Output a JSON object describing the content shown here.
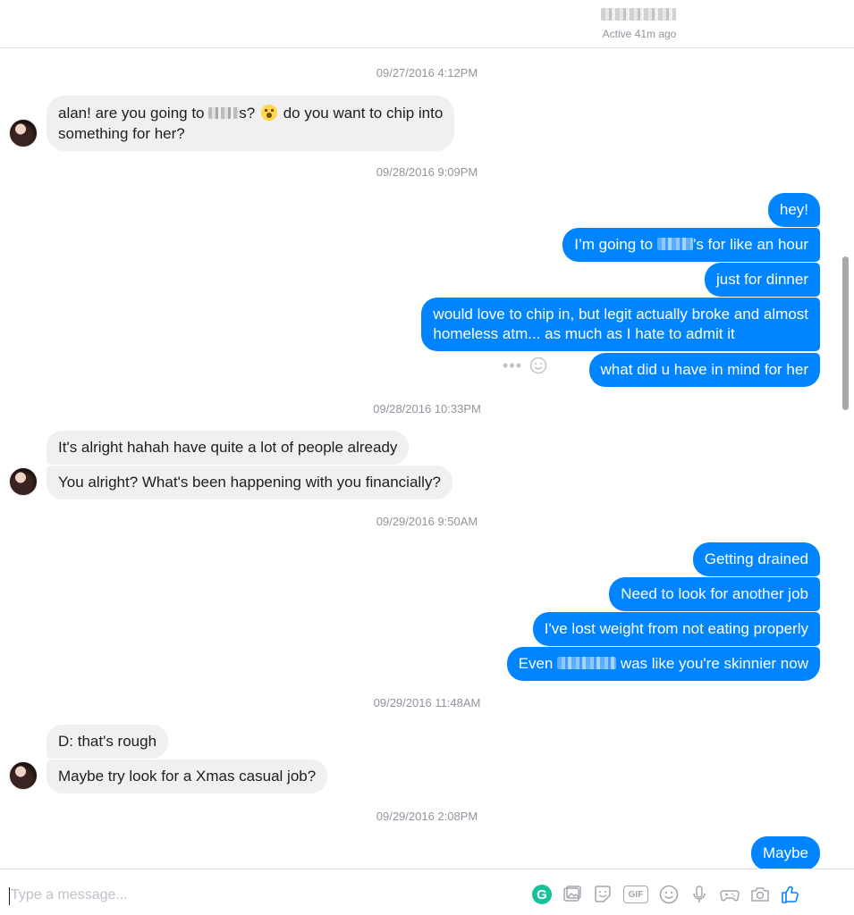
{
  "header": {
    "contact_status": "Active 41m ago"
  },
  "timestamps": [
    "09/27/2016 4:12PM",
    "09/28/2016 9:09PM",
    "09/28/2016 10:33PM",
    "09/29/2016 9:50AM",
    "09/29/2016 11:48AM",
    "09/29/2016 2:08PM"
  ],
  "messages": {
    "m1a": "alan! are you going to",
    "m1b": "s?",
    "m1c": "do you want to chip into",
    "m1d": "something for her?",
    "m2": "hey!",
    "m3a": "I’m going to",
    "m3b": "’s for like an hour",
    "m4": "just for dinner",
    "m5a": "would love to chip in, but legit actually broke and almost",
    "m5b": "homeless atm... as much as I hate to admit it",
    "m6": "what did u have in mind for her",
    "m7": "It's alright hahah have quite a lot of people already",
    "m8": "You alright? What's been happening with you financially?",
    "m9": "Getting drained",
    "m10": "Need to look for another job",
    "m11": "I've lost weight from not eating properly",
    "m12a": "Even",
    "m12b": "was like you're skinnier now",
    "m13": "D: that's rough",
    "m14": "Maybe try look for a Xmas casual job?",
    "m15": "Maybe"
  },
  "composer": {
    "placeholder": "Type a message...",
    "grammarly_label": "G",
    "gif_label": "GIF"
  },
  "icons": [
    "grammarly-icon",
    "image-icon",
    "sticker-icon",
    "gif-icon",
    "emoji-icon",
    "microphone-icon",
    "game-icon",
    "camera-icon",
    "thumbs-up-icon"
  ],
  "colors": {
    "outgoing": "#0084ff",
    "incoming": "#f1f0f0",
    "accent": "#0084ff"
  }
}
